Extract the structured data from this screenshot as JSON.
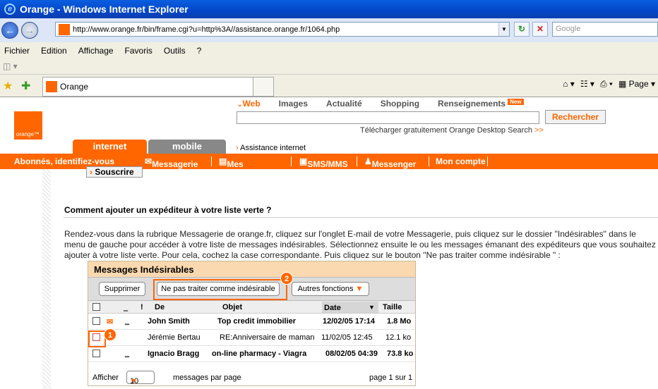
{
  "window": {
    "title": "Orange - Windows Internet Explorer"
  },
  "address": {
    "url": "http://www.orange.fr/bin/frame.cgi?u=http%3A//assistance.orange.fr/1064.php",
    "search_placeholder": "Google"
  },
  "menu": [
    "Fichier",
    "Edition",
    "Affichage",
    "Favoris",
    "Outils",
    "?"
  ],
  "tab": {
    "label": "Orange"
  },
  "toolbar_right": {
    "page_label": "Page"
  },
  "site": {
    "logo": "orange™",
    "nav": [
      "Web",
      "Images",
      "Actualité",
      "Shopping",
      "Renseignements"
    ],
    "new_badge": "New",
    "search_button": "Rechercher",
    "download_link": "Télécharger gratuitement Orange Desktop Search",
    "download_arrow": ">>",
    "tab_internet": "internet",
    "tab_mobile": "mobile",
    "assist_link": "Assistance internet",
    "orange_bar": [
      "Abonnés, identifiez-vous",
      "Messagerie",
      "Mes Contacts",
      "SMS/MMS",
      "Messenger",
      "Mon compte"
    ],
    "souscrire": "Souscrire",
    "question": "Comment ajouter un expéditeur à votre liste verte ?",
    "paragraph": "Rendez-vous dans la rubrique Messagerie de orange.fr, cliquez sur l'onglet E-mail de votre Messagerie, puis cliquez sur le dossier \"Indésirables\" dans le menu de gauche pour accéder à votre liste de messages indésirables. Sélectionnez ensuite le ou les messages émanant des expéditeurs que vous souhaitez ajouter à votre liste verte. Pour cela, cochez la case correspondante. Puis cliquez sur le bouton \"Ne pas traiter comme indésirable \" :"
  },
  "panel": {
    "title": "Messages Indésirables",
    "btn_supprimer": "Supprimer",
    "btn_nepas": "Ne pas traiter comme indésirable",
    "btn_autres": "Autres fonctions",
    "callout_1": "1",
    "callout_2": "2",
    "columns": [
      "De",
      "Objet",
      "Date",
      "Taille"
    ],
    "rows": [
      {
        "from": "John Smith",
        "subject": "Top credit immobilier",
        "date": "12/02/05 17:14",
        "size": "1.8 Mo"
      },
      {
        "from": "Jérémie Bertau",
        "subject": "RE:Anniversaire de maman",
        "date": "11/02/05 12:45",
        "size": "12.1 ko"
      },
      {
        "from": "Ignacio Bragg",
        "subject": "on-line pharmacy - Viagra",
        "date": "08/02/05 04:39",
        "size": "73.8 ko"
      }
    ],
    "footer": {
      "afficher": "Afficher",
      "per_page_value": "10",
      "per_page_label": "messages par page",
      "pager": "page 1 sur 1"
    }
  },
  "colors": {
    "accent": "#ff6600",
    "titlebar": "#0a4fd0"
  }
}
